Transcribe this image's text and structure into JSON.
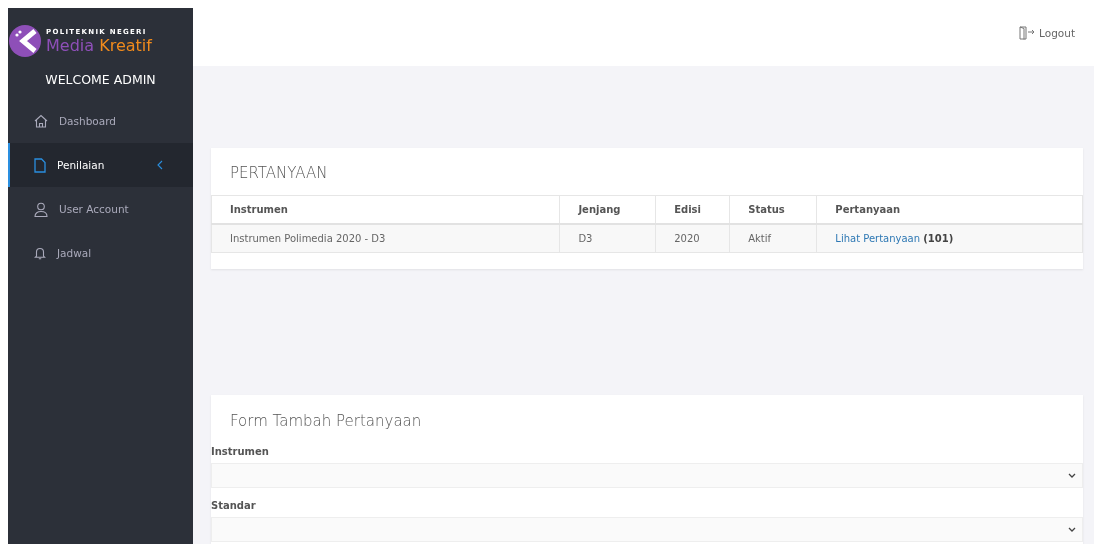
{
  "logo": {
    "tagline": "POLITEKNIK NEGERI",
    "name_first": "Media",
    "name_second": "Kreatif"
  },
  "welcome": "WELCOME ADMIN",
  "sidebar": {
    "items": [
      {
        "label": "Dashboard",
        "kind": "link",
        "selected": false
      },
      {
        "label": "Penilaian",
        "kind": "submenu",
        "selected": true
      },
      {
        "label": "User Account",
        "kind": "link",
        "selected": false
      },
      {
        "label": "Jadwal",
        "kind": "link",
        "selected": false
      }
    ]
  },
  "topbar": {
    "logout": "Logout"
  },
  "table_card": {
    "title": "PERTANYAAN",
    "columns": [
      "Instrumen",
      "Jenjang",
      "Edisi",
      "Status",
      "Pertanyaan"
    ],
    "rows": [
      {
        "instrumen": "Instrumen Polimedia 2020 - D3",
        "jenjang": "D3",
        "edisi": "2020",
        "status": "Aktif",
        "link": "Lihat Pertanyaan",
        "count": "(101)"
      }
    ]
  },
  "form_card": {
    "title": "Form Tambah Pertanyaan",
    "fields": [
      {
        "label": "Instrumen",
        "kind": "select"
      },
      {
        "label": "Standar",
        "kind": "select"
      }
    ]
  }
}
